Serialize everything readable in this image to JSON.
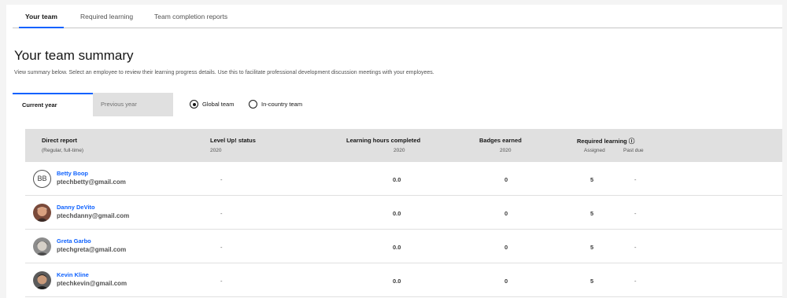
{
  "tabs": [
    "Your team",
    "Required learning",
    "Team completion reports"
  ],
  "page_title": "Your team summary",
  "description": "View summary below. Select an employee to review their learning progress details. Use this to facilitate professional development discussion meetings with your employees.",
  "year_tabs": {
    "current": "Current year",
    "previous": "Previous year"
  },
  "radios": {
    "global": "Global team",
    "in_country": "In-country team",
    "selected": "global"
  },
  "table": {
    "headers": {
      "direct_report": "Direct report",
      "direct_report_sub": "(Regular, full-time)",
      "level_up": "Level Up! status",
      "level_up_sub": "2020",
      "hours": "Learning hours completed",
      "hours_sub": "2020",
      "badges": "Badges earned",
      "badges_sub": "2020",
      "required": "Required learning ⓘ",
      "assigned": "Assigned",
      "past_due": "Past due"
    },
    "rows": [
      {
        "initials": "BB",
        "name": "Betty Boop",
        "email": "ptechbetty@gmail.com",
        "level": "-",
        "hours": "0.0",
        "badges": "0",
        "assigned": "5",
        "past_due": "-"
      },
      {
        "initials": "",
        "name": "Danny DeVito",
        "email": "ptechdanny@gmail.com",
        "level": "-",
        "hours": "0.0",
        "badges": "0",
        "assigned": "5",
        "past_due": "-"
      },
      {
        "initials": "",
        "name": "Greta Garbo",
        "email": "ptechgreta@gmail.com",
        "level": "-",
        "hours": "0.0",
        "badges": "0",
        "assigned": "5",
        "past_due": "-"
      },
      {
        "initials": "",
        "name": "Kevin Kline",
        "email": "ptechkevin@gmail.com",
        "level": "-",
        "hours": "0.0",
        "badges": "0",
        "assigned": "5",
        "past_due": "-"
      }
    ]
  },
  "colors": {
    "accent": "#0f62fe",
    "header_bg": "#e0e0e0"
  }
}
